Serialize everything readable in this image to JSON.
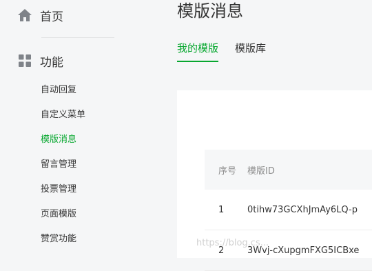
{
  "sidebar": {
    "home_label": "首页",
    "function_label": "功能",
    "items": [
      {
        "label": "自动回复"
      },
      {
        "label": "自定义菜单"
      },
      {
        "label": "模版消息",
        "active": true
      },
      {
        "label": "留言管理"
      },
      {
        "label": "投票管理"
      },
      {
        "label": "页面模版"
      },
      {
        "label": "赞赏功能"
      }
    ]
  },
  "main": {
    "title": "模版消息",
    "tabs": [
      {
        "label": "我的模版",
        "active": true
      },
      {
        "label": "模版库"
      }
    ],
    "table": {
      "headers": [
        "序号",
        "模版ID"
      ],
      "rows": [
        [
          "1",
          "0tihw73GCXhJmAy6LQ-p"
        ],
        [
          "2",
          "3Wvj-cXupgmFXG5ICBxe"
        ]
      ]
    }
  },
  "watermark": "https://blog.cs...",
  "colors": {
    "accent": "#07a72f",
    "text": "#353535",
    "muted": "#8d8d8d",
    "background": "#f5f6f7"
  }
}
